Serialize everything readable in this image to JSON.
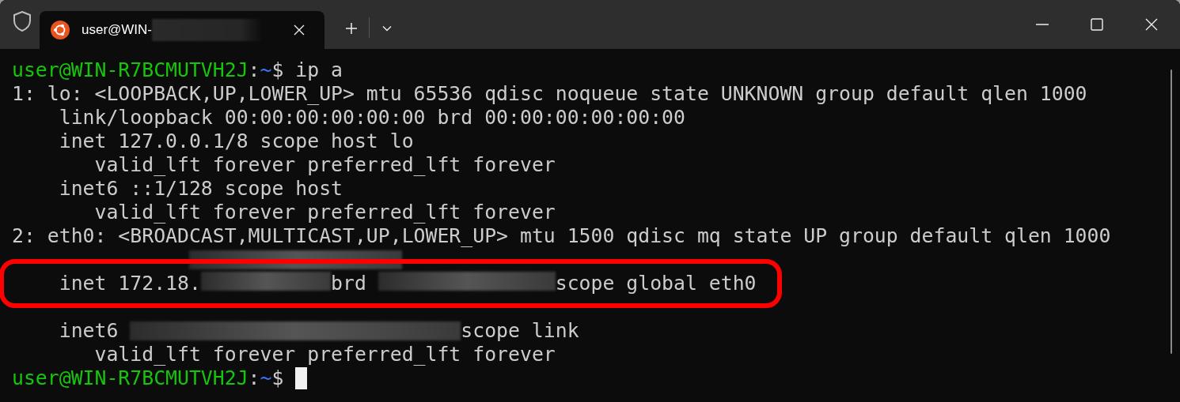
{
  "tabs": [
    {
      "title": "user@WIN-",
      "selected": true
    }
  ],
  "lines": [
    {
      "segments": [
        {
          "kind": "host",
          "text": "user@WIN-R7BCMUTVH2J"
        },
        {
          "kind": "plain",
          "text": ":"
        },
        {
          "kind": "path",
          "text": "~"
        },
        {
          "kind": "plain",
          "text": "$ ip a"
        }
      ]
    },
    {
      "segments": [
        {
          "kind": "plain",
          "text": "1: lo: <LOOPBACK,UP,LOWER_UP> mtu 65536 qdisc noqueue state UNKNOWN group default qlen 1000"
        }
      ]
    },
    {
      "segments": [
        {
          "kind": "plain",
          "text": "    link/loopback 00:00:00:00:00:00 brd 00:00:00:00:00:00"
        }
      ]
    },
    {
      "segments": [
        {
          "kind": "plain",
          "text": "    inet 127.0.0.1/8 scope host lo"
        }
      ]
    },
    {
      "segments": [
        {
          "kind": "plain",
          "text": "       valid_lft forever preferred_lft forever"
        }
      ]
    },
    {
      "segments": [
        {
          "kind": "plain",
          "text": "    inet6 ::1/128 scope host"
        }
      ]
    },
    {
      "segments": [
        {
          "kind": "plain",
          "text": "       valid_lft forever preferred_lft forever"
        }
      ]
    },
    {
      "segments": [
        {
          "kind": "plain",
          "text": "2: eth0: <BROADCAST,MULTICAST,UP,LOWER_UP> mtu 1500 qdisc mq state UP group default qlen 1000"
        }
      ]
    },
    {
      "segments": [
        {
          "kind": "redacted"
        }
      ]
    },
    {
      "highlighted": true,
      "segments": [
        {
          "kind": "plain",
          "text": "    inet 172.18."
        },
        {
          "kind": "redacted"
        },
        {
          "kind": "plain",
          "text": "brd "
        },
        {
          "kind": "redacted"
        },
        {
          "kind": "plain",
          "text": "scope global eth0"
        }
      ]
    },
    {
      "segments": [
        {
          "kind": "plain",
          "text": "    inet6 "
        },
        {
          "kind": "redacted"
        },
        {
          "kind": "plain",
          "text": "scope link"
        }
      ]
    },
    {
      "segments": [
        {
          "kind": "plain",
          "text": "       valid_lft forever preferred_lft forever"
        }
      ]
    },
    {
      "segments": [
        {
          "kind": "host",
          "text": "user@WIN-R7BCMUTVH2J"
        },
        {
          "kind": "plain",
          "text": ":"
        },
        {
          "kind": "path",
          "text": "~"
        },
        {
          "kind": "plain",
          "text": "$ "
        },
        {
          "kind": "cursor"
        }
      ]
    }
  ]
}
